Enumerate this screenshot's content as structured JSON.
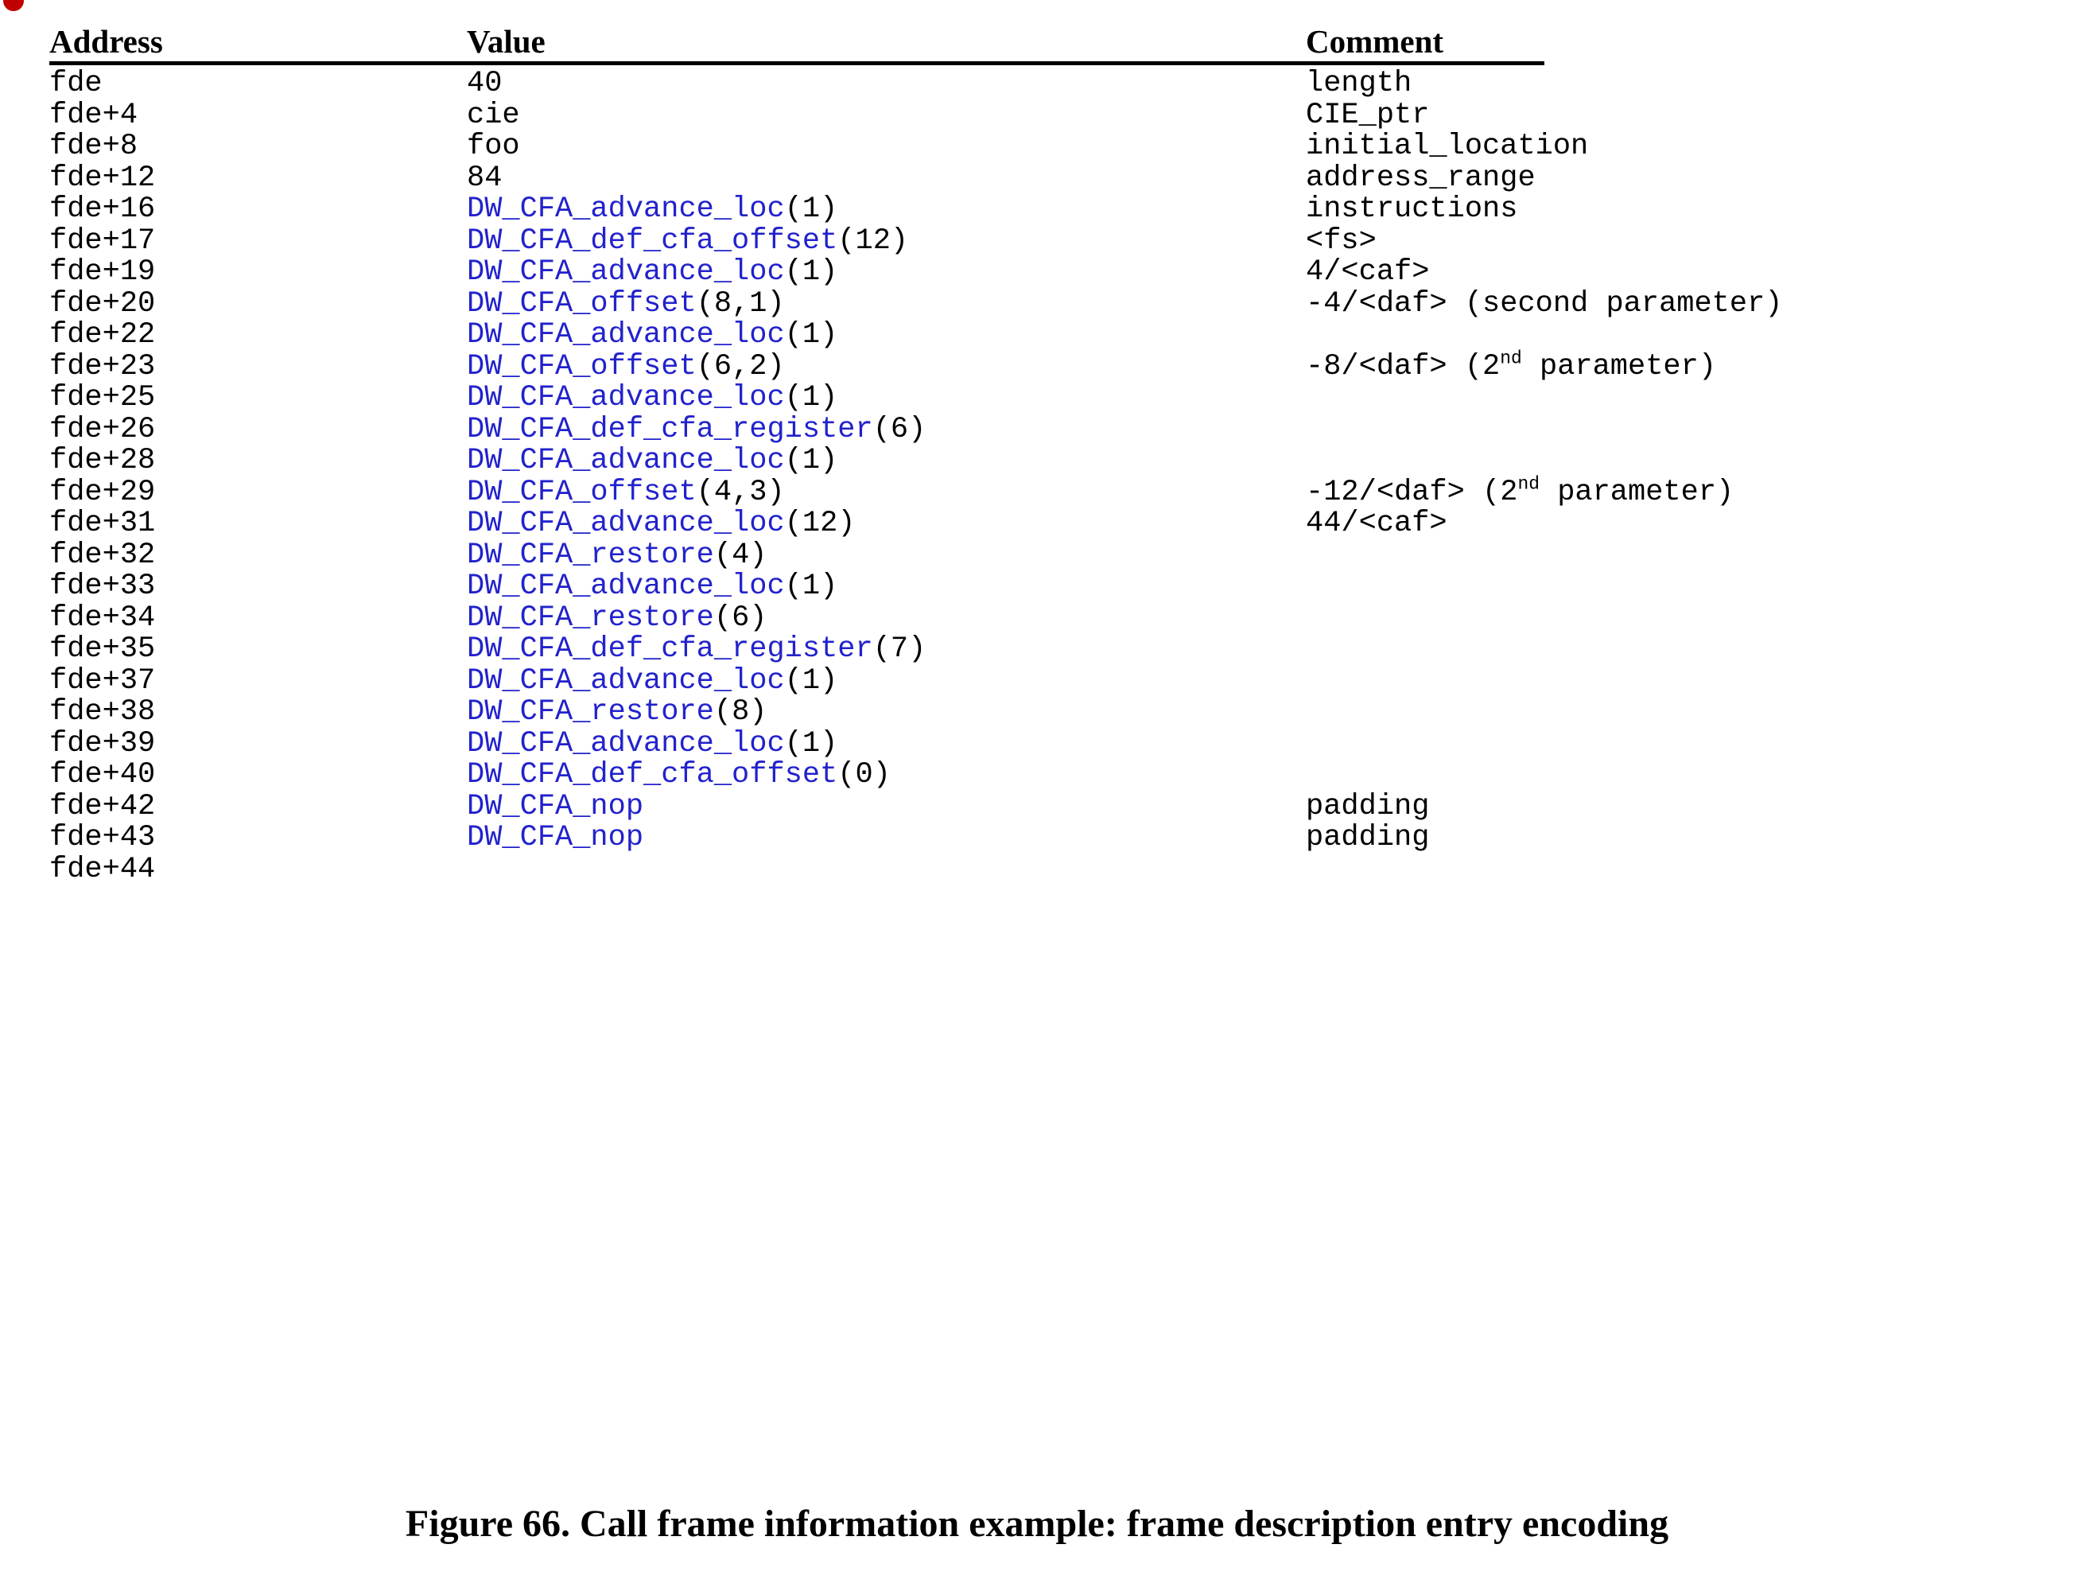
{
  "colors": {
    "keyword_blue": "#2222CC",
    "text_black": "#000000",
    "page_background": "#FFFFFF",
    "artifact_red": "#C00000"
  },
  "table": {
    "headers": {
      "address": "Address",
      "value": "Value",
      "comment": "Comment"
    },
    "rows": [
      {
        "address": "fde",
        "value_keyword": "",
        "value_arg": "40",
        "value_plain": "40",
        "comment": "length",
        "comment_sup": ""
      },
      {
        "address": "fde+4",
        "value_keyword": "",
        "value_arg": "",
        "value_plain": "cie",
        "comment": "CIE_ptr",
        "comment_sup": ""
      },
      {
        "address": "fde+8",
        "value_keyword": "",
        "value_arg": "",
        "value_plain": "foo",
        "comment": "initial_location",
        "comment_sup": ""
      },
      {
        "address": "fde+12",
        "value_keyword": "",
        "value_arg": "",
        "value_plain": "84",
        "comment": "address_range",
        "comment_sup": ""
      },
      {
        "address": "fde+16",
        "value_keyword": "DW_CFA_advance_loc",
        "value_arg": "(1)",
        "value_plain": "",
        "comment": "instructions",
        "comment_sup": ""
      },
      {
        "address": "fde+17",
        "value_keyword": "DW_CFA_def_cfa_offset",
        "value_arg": "(12)",
        "value_plain": "",
        "comment": "<fs>",
        "comment_sup": ""
      },
      {
        "address": "fde+19",
        "value_keyword": "DW_CFA_advance_loc",
        "value_arg": "(1)",
        "value_plain": "",
        "comment": "4/<caf>",
        "comment_sup": ""
      },
      {
        "address": "fde+20",
        "value_keyword": "DW_CFA_offset",
        "value_arg": "(8,1)",
        "value_plain": "",
        "comment": "-4/<daf> (second parameter)",
        "comment_sup": ""
      },
      {
        "address": "fde+22",
        "value_keyword": "DW_CFA_advance_loc",
        "value_arg": "(1)",
        "value_plain": "",
        "comment": "",
        "comment_sup": ""
      },
      {
        "address": "fde+23",
        "value_keyword": "DW_CFA_offset",
        "value_arg": "(6,2)",
        "value_plain": "",
        "comment_pre": "-8/<daf> (2",
        "comment_sup": "nd",
        "comment_post": " parameter)",
        "comment": ""
      },
      {
        "address": "fde+25",
        "value_keyword": "DW_CFA_advance_loc",
        "value_arg": "(1)",
        "value_plain": "",
        "comment": "",
        "comment_sup": ""
      },
      {
        "address": "fde+26",
        "value_keyword": "DW_CFA_def_cfa_register",
        "value_arg": "(6)",
        "value_plain": "",
        "comment": "",
        "comment_sup": ""
      },
      {
        "address": "fde+28",
        "value_keyword": "DW_CFA_advance_loc",
        "value_arg": "(1)",
        "value_plain": "",
        "comment": "",
        "comment_sup": ""
      },
      {
        "address": "fde+29",
        "value_keyword": "DW_CFA_offset",
        "value_arg": "(4,3)",
        "value_plain": "",
        "comment_pre": "-12/<daf> (2",
        "comment_sup": "nd",
        "comment_post": " parameter)",
        "comment": ""
      },
      {
        "address": "fde+31",
        "value_keyword": "DW_CFA_advance_loc",
        "value_arg": "(12)",
        "value_plain": "",
        "comment": "44/<caf>",
        "comment_sup": ""
      },
      {
        "address": "fde+32",
        "value_keyword": "DW_CFA_restore",
        "value_arg": "(4)",
        "value_plain": "",
        "comment": "",
        "comment_sup": ""
      },
      {
        "address": "fde+33",
        "value_keyword": "DW_CFA_advance_loc",
        "value_arg": "(1)",
        "value_plain": "",
        "comment": "",
        "comment_sup": ""
      },
      {
        "address": "fde+34",
        "value_keyword": "DW_CFA_restore",
        "value_arg": "(6)",
        "value_plain": "",
        "comment": "",
        "comment_sup": ""
      },
      {
        "address": "fde+35",
        "value_keyword": "DW_CFA_def_cfa_register",
        "value_arg": "(7)",
        "value_plain": "",
        "comment": "",
        "comment_sup": ""
      },
      {
        "address": "fde+37",
        "value_keyword": "DW_CFA_advance_loc",
        "value_arg": "(1)",
        "value_plain": "",
        "comment": "",
        "comment_sup": ""
      },
      {
        "address": "fde+38",
        "value_keyword": "DW_CFA_restore",
        "value_arg": "(8)",
        "value_plain": "",
        "comment": "",
        "comment_sup": ""
      },
      {
        "address": "fde+39",
        "value_keyword": "DW_CFA_advance_loc",
        "value_arg": "(1)",
        "value_plain": "",
        "comment": "",
        "comment_sup": ""
      },
      {
        "address": "fde+40",
        "value_keyword": "DW_CFA_def_cfa_offset",
        "value_arg": "(0)",
        "value_plain": "",
        "comment": "",
        "comment_sup": ""
      },
      {
        "address": "fde+42",
        "value_keyword": "DW_CFA_nop",
        "value_arg": "",
        "value_plain": "",
        "comment": "padding",
        "comment_sup": ""
      },
      {
        "address": "fde+43",
        "value_keyword": "DW_CFA_nop",
        "value_arg": "",
        "value_plain": "",
        "comment": "padding",
        "comment_sup": ""
      },
      {
        "address": "fde+44",
        "value_keyword": "",
        "value_arg": "",
        "value_plain": "",
        "comment": "",
        "comment_sup": ""
      }
    ]
  },
  "caption": "Figure 66. Call frame information example: frame description entry encoding"
}
